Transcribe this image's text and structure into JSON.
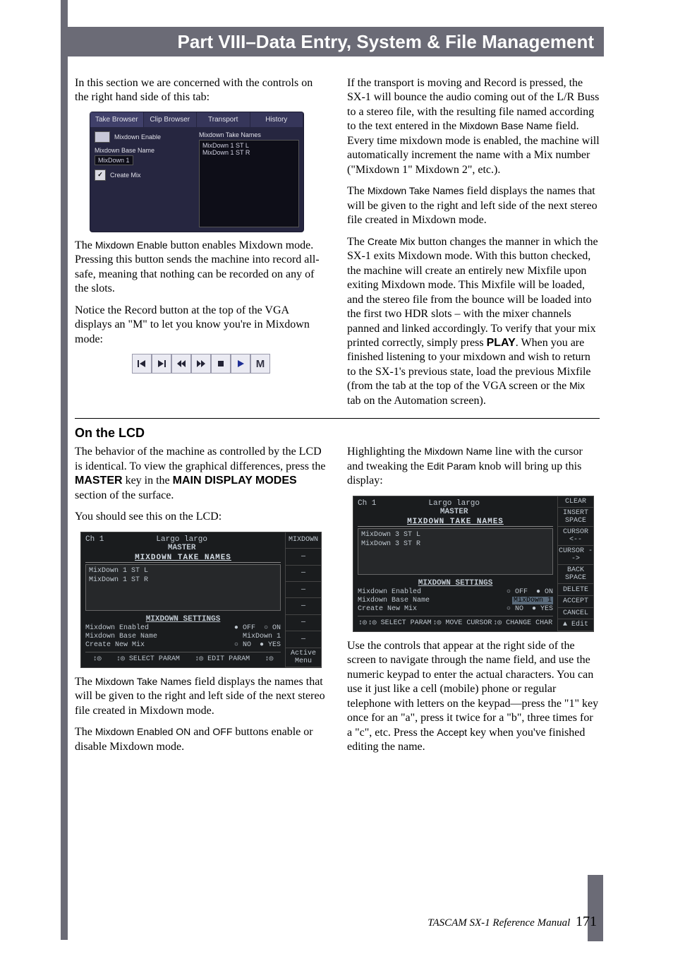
{
  "header": {
    "title": "Part VIII–Data Entry, System & File Management"
  },
  "intro": {
    "p1": "In this section we are concerned with the controls on the right hand side of this tab:",
    "p2a": "The ",
    "p2term": "Mixdown Enable",
    "p2b": " button enables Mixdown mode. Pressing this button sends the machine into record all-safe, meaning that nothing can be recorded on any of the slots.",
    "p3": "Notice the Record button at the top of the VGA displays an \"M\" to let you know you're in Mixdown mode:",
    "r1a": "If the transport is moving and Record is pressed, the SX-1 will bounce the audio coming out of the L/R Buss to a stereo file, with the resulting file named according to the text entered in the ",
    "r1term": "Mixdown Base Name",
    "r1b": " field. Every time mixdown mode is enabled, the machine will automatically increment the name with a Mix number (\"Mixdown 1\" Mixdown 2\", etc.).",
    "r2a": "The ",
    "r2term": "Mixdown Take Names",
    "r2b": " field displays the names that will be given to the right and left side of the next stereo file created in Mixdown mode.",
    "r3a": "The ",
    "r3term": "Create Mix",
    "r3b": " button changes the manner in which the SX-1 exits Mixdown mode. With this button checked, the machine will create an entirely new Mixfile upon exiting Mixdown mode. This Mixfile will be loaded, and the stereo file from the bounce will be loaded into the first two HDR slots – with the mixer channels panned and linked accordingly. To verify that your mix printed correctly, simply press ",
    "r3play": "PLAY",
    "r3c": ". When you are finished listening to your mixdown and wish to return to the SX-1's previous state, load the previous Mixfile (from the tab at the top of the VGA screen or the ",
    "r3mix": "Mix",
    "r3d": " tab on the Automation screen)."
  },
  "vga": {
    "tabs": [
      "Take Browser",
      "Clip Browser",
      "Transport",
      "History"
    ],
    "mixdown_enable": "Mixdown Enable",
    "base_name_label": "Mixdown Base Name",
    "base_name_value": "MixDown 1",
    "create_mix": "Create Mix",
    "take_names_label": "Mixdown Take Names",
    "take_names": [
      "MixDown 1 ST L",
      "MixDown 1 ST R"
    ]
  },
  "transport": {
    "m": "M"
  },
  "lcd_section": {
    "heading": "On the LCD",
    "p1a": "The behavior of the machine as controlled by the LCD is identical. To view the graphical differences, press the ",
    "p1k1": "MASTER",
    "p1b": " key in the ",
    "p1k2": "MAIN DISPLAY MODES",
    "p1c": " section of the surface.",
    "p2": "You should see this on the LCD:",
    "p3a": "The ",
    "p3term": "Mixdown Take Names",
    "p3b": " field displays the names that will be given to the right and left side of the next stereo file created in Mixdown mode.",
    "p4a": "The ",
    "p4term1": "Mixdown Enabled ON",
    "p4mid": " and ",
    "p4term2": "OFF",
    "p4b": " buttons enable or disable Mixdown mode.",
    "r1a": "Highlighting the ",
    "r1term": "Mixdown Name",
    "r1b": " line with the cursor and tweaking the ",
    "r1term2": "Edit Param",
    "r1c": " knob will bring up this display:",
    "r2a": "Use the controls that appear at the right side of the screen to navigate through the name field, and use the numeric keypad to enter the actual characters. You can use it just like a cell (mobile) phone or regular telephone with letters on the keypad—press the \"1\" key once for an \"a\", press it twice for a \"b\", three times for a \"c\", etc. Press the ",
    "r2term": "Accept",
    "r2b": " key when you've finished editing the name."
  },
  "lcd1": {
    "ch": "Ch 1",
    "title_top": "Largo largo",
    "title_main": "MASTER",
    "side": [
      "MIXDOWN",
      "—",
      "—",
      "—",
      "—",
      "—",
      "—",
      "Active\nMenu"
    ],
    "take_title": "MIXDOWN TAKE NAMES",
    "takes": [
      "MixDown 1 ST L",
      "MixDown 1 ST R"
    ],
    "settings_title": "MIXDOWN SETTINGS",
    "rows": {
      "enabled_label": "Mixdown Enabled",
      "enabled_off": "OFF",
      "enabled_on": "ON",
      "base_label": "Mixdown Base Name",
      "base_value": "MixDown 1",
      "create_label": "Create New Mix",
      "create_no": "NO",
      "create_yes": "YES"
    },
    "bottom": [
      "↕◎",
      "↕◎ SELECT PARAM",
      "↕◎ EDIT PARAM",
      "↕◎"
    ]
  },
  "lcd2": {
    "ch": "Ch 1",
    "title_top": "Largo largo",
    "title_main": "MASTER",
    "side": [
      "CLEAR",
      "INSERT SPACE",
      "CURSOR <--",
      "CURSOR -->",
      "BACK SPACE",
      "DELETE",
      "ACCEPT",
      "CANCEL",
      "▲ Edit"
    ],
    "take_title": "MIXDOWN TAKE NAMES",
    "takes": [
      "MixDown 3 ST L",
      "MixDown 3 ST R"
    ],
    "settings_title": "MIXDOWN SETTINGS",
    "rows": {
      "enabled_label": "Mixdown Enabled",
      "enabled_off": "OFF",
      "enabled_on": "ON",
      "base_label": "Mixdown Base Name",
      "base_value": "MixDown 1",
      "create_label": "Create New Mix",
      "create_no": "NO",
      "create_yes": "YES"
    },
    "bottom": [
      "↕◎",
      "↕◎ SELECT PARAM",
      "↕◎ MOVE CURSOR",
      "↕◎ CHANGE CHAR"
    ]
  },
  "footer": {
    "label": "TASCAM SX-1 Reference Manual",
    "page": "171"
  }
}
